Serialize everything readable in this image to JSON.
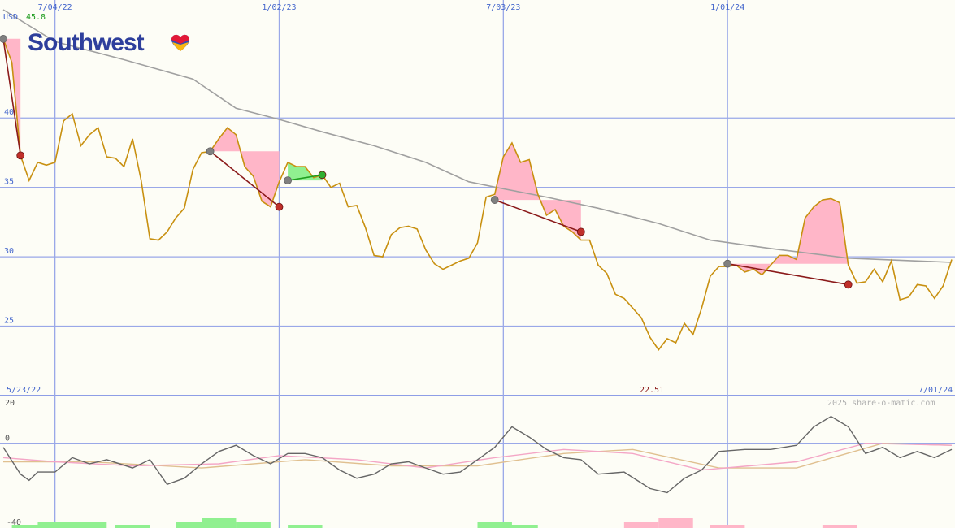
{
  "brand": {
    "name": "Southwest",
    "colors": {
      "logo_text": "#2e3f9c",
      "heart_red": "#e31837",
      "heart_yellow": "#f9b612",
      "heart_blue": "#304cb2"
    }
  },
  "header": {
    "currency_label": "USD",
    "top_value": "45.8"
  },
  "footer": {
    "start_date": "5/23/22",
    "end_date": "7/01/24",
    "low_value": "22.51",
    "credit": "2025 share-o-matic.com"
  },
  "colors": {
    "background": "#fdfdf6",
    "grid": "#9aa8e8",
    "price": "#c89010",
    "ma": "#a0a0a0",
    "gain_fill": "#90f090",
    "loss_fill": "#ffb6c8",
    "loss_line": "#8b1a1a",
    "gain_line": "#1e9e1e",
    "osc": "#666666",
    "osc_pink": "#f4a6c6",
    "osc_tan": "#e0c090"
  },
  "chart_data": {
    "type": "line",
    "title": "",
    "price_axis": {
      "ylim": [
        20,
        48.5
      ],
      "ticks": [
        25,
        30,
        35,
        40
      ],
      "tick_labels": [
        "25",
        "30",
        "35",
        "40"
      ]
    },
    "date_ticks": [
      "7/04/22",
      "1/02/23",
      "7/03/23",
      "1/01/24"
    ],
    "series": [
      {
        "name": "Price",
        "values": [
          [
            "2022-05-23",
            45.7
          ],
          [
            "2022-05-30",
            44.0
          ],
          [
            "2022-06-06",
            37.3
          ],
          [
            "2022-06-13",
            35.5
          ],
          [
            "2022-06-20",
            36.8
          ],
          [
            "2022-06-27",
            36.6
          ],
          [
            "2022-07-04",
            36.8
          ],
          [
            "2022-07-11",
            39.8
          ],
          [
            "2022-07-18",
            40.3
          ],
          [
            "2022-07-25",
            38.0
          ],
          [
            "2022-08-01",
            38.8
          ],
          [
            "2022-08-08",
            39.3
          ],
          [
            "2022-08-15",
            37.2
          ],
          [
            "2022-08-22",
            37.1
          ],
          [
            "2022-08-29",
            36.5
          ],
          [
            "2022-09-05",
            38.5
          ],
          [
            "2022-09-12",
            35.5
          ],
          [
            "2022-09-19",
            31.3
          ],
          [
            "2022-09-26",
            31.2
          ],
          [
            "2022-10-03",
            31.8
          ],
          [
            "2022-10-10",
            32.8
          ],
          [
            "2022-10-17",
            33.5
          ],
          [
            "2022-10-24",
            36.3
          ],
          [
            "2022-10-31",
            37.5
          ],
          [
            "2022-11-07",
            37.6
          ],
          [
            "2022-11-14",
            38.5
          ],
          [
            "2022-11-21",
            39.3
          ],
          [
            "2022-11-28",
            38.8
          ],
          [
            "2022-12-05",
            36.5
          ],
          [
            "2022-12-12",
            35.8
          ],
          [
            "2022-12-19",
            34.0
          ],
          [
            "2022-12-26",
            33.6
          ],
          [
            "2023-01-02",
            35.4
          ],
          [
            "2023-01-09",
            36.8
          ],
          [
            "2023-01-16",
            36.5
          ],
          [
            "2023-01-23",
            36.5
          ],
          [
            "2023-01-30",
            35.7
          ],
          [
            "2023-02-06",
            35.9
          ],
          [
            "2023-02-13",
            35.0
          ],
          [
            "2023-02-20",
            35.3
          ],
          [
            "2023-02-27",
            33.6
          ],
          [
            "2023-03-06",
            33.7
          ],
          [
            "2023-03-13",
            32.1
          ],
          [
            "2023-03-20",
            30.1
          ],
          [
            "2023-03-27",
            30.0
          ],
          [
            "2023-04-03",
            31.6
          ],
          [
            "2023-04-10",
            32.1
          ],
          [
            "2023-04-17",
            32.2
          ],
          [
            "2023-04-24",
            32.0
          ],
          [
            "2023-05-01",
            30.5
          ],
          [
            "2023-05-08",
            29.5
          ],
          [
            "2023-05-15",
            29.1
          ],
          [
            "2023-05-22",
            29.4
          ],
          [
            "2023-05-29",
            29.7
          ],
          [
            "2023-06-05",
            29.9
          ],
          [
            "2023-06-12",
            31.0
          ],
          [
            "2023-06-19",
            34.3
          ],
          [
            "2023-06-26",
            34.5
          ],
          [
            "2023-07-03",
            37.2
          ],
          [
            "2023-07-10",
            38.2
          ],
          [
            "2023-07-17",
            36.8
          ],
          [
            "2023-07-24",
            37.0
          ],
          [
            "2023-07-31",
            34.5
          ],
          [
            "2023-08-07",
            33.0
          ],
          [
            "2023-08-14",
            33.4
          ],
          [
            "2023-08-21",
            32.2
          ],
          [
            "2023-08-28",
            31.8
          ],
          [
            "2023-09-04",
            31.2
          ],
          [
            "2023-09-11",
            31.2
          ],
          [
            "2023-09-18",
            29.4
          ],
          [
            "2023-09-25",
            28.8
          ],
          [
            "2023-10-02",
            27.3
          ],
          [
            "2023-10-09",
            27.0
          ],
          [
            "2023-10-16",
            26.3
          ],
          [
            "2023-10-23",
            25.6
          ],
          [
            "2023-10-30",
            24.2
          ],
          [
            "2023-11-06",
            23.3
          ],
          [
            "2023-11-13",
            24.1
          ],
          [
            "2023-11-20",
            23.8
          ],
          [
            "2023-11-27",
            25.2
          ],
          [
            "2023-12-04",
            24.4
          ],
          [
            "2023-12-11",
            26.3
          ],
          [
            "2023-12-18",
            28.6
          ],
          [
            "2023-12-25",
            29.3
          ],
          [
            "2024-01-01",
            29.3
          ],
          [
            "2024-01-08",
            29.4
          ],
          [
            "2024-01-15",
            28.9
          ],
          [
            "2024-01-22",
            29.1
          ],
          [
            "2024-01-29",
            28.7
          ],
          [
            "2024-02-05",
            29.4
          ],
          [
            "2024-02-12",
            30.1
          ],
          [
            "2024-02-19",
            30.1
          ],
          [
            "2024-02-26",
            29.8
          ],
          [
            "2024-03-04",
            32.8
          ],
          [
            "2024-03-11",
            33.6
          ],
          [
            "2024-03-18",
            34.1
          ],
          [
            "2024-03-25",
            34.2
          ],
          [
            "2024-04-01",
            33.9
          ],
          [
            "2024-04-08",
            29.4
          ],
          [
            "2024-04-15",
            28.1
          ],
          [
            "2024-04-22",
            28.2
          ],
          [
            "2024-04-29",
            29.1
          ],
          [
            "2024-05-06",
            28.2
          ],
          [
            "2024-05-13",
            29.7
          ],
          [
            "2024-05-20",
            26.9
          ],
          [
            "2024-05-27",
            27.1
          ],
          [
            "2024-06-03",
            28.0
          ],
          [
            "2024-06-10",
            27.9
          ],
          [
            "2024-06-17",
            27.0
          ],
          [
            "2024-06-24",
            27.9
          ],
          [
            "2024-07-01",
            29.8
          ]
        ]
      },
      {
        "name": "Moving average",
        "values": [
          [
            "2022-05-23",
            47.8
          ],
          [
            "2022-07-04",
            45.5
          ],
          [
            "2022-08-29",
            44.2
          ],
          [
            "2022-10-24",
            42.8
          ],
          [
            "2022-11-28",
            40.7
          ],
          [
            "2023-01-02",
            39.9
          ],
          [
            "2023-02-06",
            39.0
          ],
          [
            "2023-03-20",
            38.0
          ],
          [
            "2023-05-01",
            36.8
          ],
          [
            "2023-06-05",
            35.4
          ],
          [
            "2023-07-03",
            34.9
          ],
          [
            "2023-08-07",
            34.3
          ],
          [
            "2023-09-18",
            33.5
          ],
          [
            "2023-11-06",
            32.4
          ],
          [
            "2023-12-18",
            31.2
          ],
          [
            "2024-02-05",
            30.6
          ],
          [
            "2024-04-08",
            29.9
          ],
          [
            "2024-07-01",
            29.6
          ]
        ]
      }
    ],
    "signals": [
      {
        "type": "loss",
        "start": [
          "2022-05-23",
          45.7
        ],
        "end": [
          "2022-06-06",
          37.3
        ]
      },
      {
        "type": "loss",
        "start": [
          "2022-11-07",
          37.6
        ],
        "end": [
          "2023-01-02",
          33.6
        ]
      },
      {
        "type": "gain",
        "start": [
          "2023-01-09",
          35.5
        ],
        "end": [
          "2023-02-06",
          35.9
        ]
      },
      {
        "type": "loss",
        "start": [
          "2023-06-26",
          34.1
        ],
        "end": [
          "2023-09-04",
          31.8
        ]
      },
      {
        "type": "loss",
        "start": [
          "2024-01-01",
          29.5
        ],
        "end": [
          "2024-04-08",
          28.0
        ]
      }
    ],
    "oscillator": {
      "ylim": [
        -40,
        20
      ],
      "tick_labels": [
        "20",
        "0",
        "-40"
      ],
      "series": [
        {
          "name": "Oscillator",
          "values": [
            [
              "2022-05-23",
              -2
            ],
            [
              "2022-06-06",
              -15
            ],
            [
              "2022-06-13",
              -18
            ],
            [
              "2022-06-20",
              -14
            ],
            [
              "2022-07-04",
              -14
            ],
            [
              "2022-07-18",
              -7
            ],
            [
              "2022-08-01",
              -10
            ],
            [
              "2022-08-15",
              -8
            ],
            [
              "2022-09-05",
              -12
            ],
            [
              "2022-09-19",
              -8
            ],
            [
              "2022-10-03",
              -20
            ],
            [
              "2022-10-17",
              -17
            ],
            [
              "2022-10-31",
              -10
            ],
            [
              "2022-11-14",
              -4
            ],
            [
              "2022-11-28",
              -1
            ],
            [
              "2022-12-12",
              -6
            ],
            [
              "2022-12-26",
              -10
            ],
            [
              "2023-01-09",
              -5
            ],
            [
              "2023-01-23",
              -5
            ],
            [
              "2023-02-06",
              -7
            ],
            [
              "2023-02-20",
              -13
            ],
            [
              "2023-03-06",
              -17
            ],
            [
              "2023-03-20",
              -15
            ],
            [
              "2023-04-03",
              -10
            ],
            [
              "2023-04-17",
              -9
            ],
            [
              "2023-05-01",
              -12
            ],
            [
              "2023-05-15",
              -15
            ],
            [
              "2023-05-29",
              -14
            ],
            [
              "2023-06-12",
              -8
            ],
            [
              "2023-06-26",
              -2
            ],
            [
              "2023-07-10",
              8
            ],
            [
              "2023-07-24",
              3
            ],
            [
              "2023-08-07",
              -3
            ],
            [
              "2023-08-21",
              -7
            ],
            [
              "2023-09-04",
              -8
            ],
            [
              "2023-09-18",
              -15
            ],
            [
              "2023-10-09",
              -14
            ],
            [
              "2023-10-30",
              -22
            ],
            [
              "2023-11-13",
              -24
            ],
            [
              "2023-11-27",
              -17
            ],
            [
              "2023-12-11",
              -13
            ],
            [
              "2023-12-25",
              -4
            ],
            [
              "2024-01-15",
              -3
            ],
            [
              "2024-02-05",
              -3
            ],
            [
              "2024-02-26",
              -1
            ],
            [
              "2024-03-11",
              8
            ],
            [
              "2024-03-25",
              13
            ],
            [
              "2024-04-08",
              8
            ],
            [
              "2024-04-22",
              -5
            ],
            [
              "2024-05-06",
              -2
            ],
            [
              "2024-05-20",
              -7
            ],
            [
              "2024-06-03",
              -4
            ],
            [
              "2024-06-17",
              -7
            ],
            [
              "2024-07-01",
              -3
            ]
          ]
        },
        {
          "name": "Signal (pink)",
          "values": [
            [
              "2022-05-23",
              -7
            ],
            [
              "2022-07-04",
              -9
            ],
            [
              "2022-09-05",
              -11
            ],
            [
              "2022-11-14",
              -10
            ],
            [
              "2023-01-02",
              -6
            ],
            [
              "2023-03-06",
              -8
            ],
            [
              "2023-05-01",
              -12
            ],
            [
              "2023-06-26",
              -7
            ],
            [
              "2023-08-21",
              -3
            ],
            [
              "2023-10-16",
              -5
            ],
            [
              "2023-12-11",
              -13
            ],
            [
              "2024-02-26",
              -9
            ],
            [
              "2024-04-22",
              0
            ],
            [
              "2024-07-01",
              -1
            ]
          ]
        },
        {
          "name": "Signal (tan)",
          "values": [
            [
              "2022-05-23",
              -9
            ],
            [
              "2022-08-01",
              -9
            ],
            [
              "2022-10-31",
              -12
            ],
            [
              "2023-01-23",
              -8
            ],
            [
              "2023-04-03",
              -11
            ],
            [
              "2023-06-12",
              -11
            ],
            [
              "2023-08-21",
              -5
            ],
            [
              "2023-10-16",
              -3
            ],
            [
              "2023-12-25",
              -12
            ],
            [
              "2024-02-26",
              -12
            ],
            [
              "2024-05-06",
              0
            ],
            [
              "2024-07-01",
              -1
            ]
          ]
        }
      ]
    },
    "volume": {
      "gain_weeks": [
        [
          "2022-06-13",
          1
        ],
        [
          "2022-07-04",
          2
        ],
        [
          "2022-08-01",
          2
        ],
        [
          "2022-09-05",
          1
        ],
        [
          "2022-10-24",
          2
        ],
        [
          "2022-11-14",
          3
        ],
        [
          "2022-12-12",
          2
        ],
        [
          "2023-01-23",
          1
        ],
        [
          "2023-06-26",
          2
        ],
        [
          "2023-07-17",
          1
        ]
      ],
      "loss_weeks": [
        [
          "2023-10-23",
          2
        ],
        [
          "2023-11-20",
          3
        ],
        [
          "2024-01-01",
          1
        ],
        [
          "2024-04-01",
          1
        ]
      ]
    }
  }
}
